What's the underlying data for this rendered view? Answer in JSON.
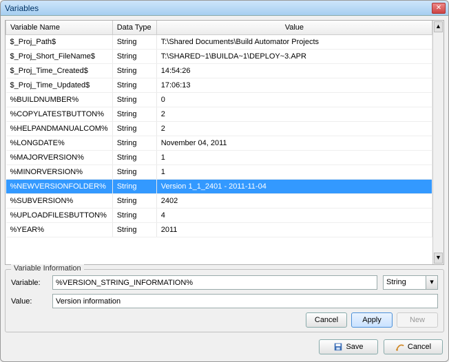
{
  "window": {
    "title": "Variables"
  },
  "grid": {
    "columns": [
      "Variable Name",
      "Data Type",
      "Value"
    ],
    "rows": [
      {
        "name": "$_Proj_Path$",
        "type": "String",
        "value": "T:\\Shared Documents\\Build Automator Projects"
      },
      {
        "name": "$_Proj_Short_FileName$",
        "type": "String",
        "value": "T:\\SHARED~1\\BUILDA~1\\DEPLOY~3.APR"
      },
      {
        "name": "$_Proj_Time_Created$",
        "type": "String",
        "value": "14:54:26"
      },
      {
        "name": "$_Proj_Time_Updated$",
        "type": "String",
        "value": "17:06:13"
      },
      {
        "name": "%BUILDNUMBER%",
        "type": "String",
        "value": "0"
      },
      {
        "name": "%COPYLATESTBUTTON%",
        "type": "String",
        "value": "2"
      },
      {
        "name": "%HELPANDMANUALCOM%",
        "type": "String",
        "value": "2"
      },
      {
        "name": "%LONGDATE%",
        "type": "String",
        "value": "November 04, 2011"
      },
      {
        "name": "%MAJORVERSION%",
        "type": "String",
        "value": "1"
      },
      {
        "name": "%MINORVERSION%",
        "type": "String",
        "value": "1"
      },
      {
        "name": "%NEWVERSIONFOLDER%",
        "type": "String",
        "value": "Version 1_1_2401 - 2011-11-04"
      },
      {
        "name": "%SUBVERSION%",
        "type": "String",
        "value": "2402"
      },
      {
        "name": "%UPLOADFILESBUTTON%",
        "type": "String",
        "value": "4"
      },
      {
        "name": "%YEAR%",
        "type": "String",
        "value": "2011"
      }
    ],
    "selected_index": 10
  },
  "info": {
    "group_title": "Variable Information",
    "variable_label": "Variable:",
    "variable_value": "%VERSION_STRING_INFORMATION%",
    "type_value": "String",
    "value_label": "Value:",
    "value_value": "Version information",
    "buttons": {
      "cancel": "Cancel",
      "apply": "Apply",
      "new": "New"
    }
  },
  "footer": {
    "save": "Save",
    "cancel": "Cancel"
  }
}
